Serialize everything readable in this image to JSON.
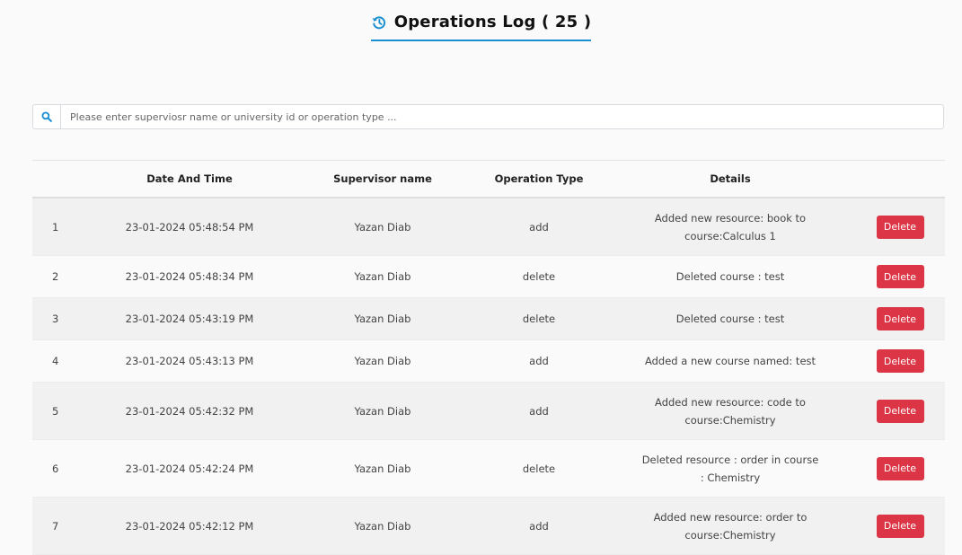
{
  "header": {
    "title": "Operations Log ( 25 )",
    "icon": "history-icon",
    "accent_color": "#1a8fd1"
  },
  "search": {
    "icon": "search-icon",
    "placeholder": "Please enter superviosr name or university id or operation type ..."
  },
  "table": {
    "columns": [
      "",
      "Date And Time",
      "Supervisor name",
      "Operation Type",
      "Details",
      ""
    ],
    "delete_label": "Delete",
    "delete_color": "#dc3545",
    "rows": [
      {
        "num": "1",
        "datetime": "23-01-2024 05:48:54 PM",
        "supervisor": "Yazan Diab",
        "operation": "add",
        "details": "Added new resource: book to course:Calculus 1"
      },
      {
        "num": "2",
        "datetime": "23-01-2024 05:48:34 PM",
        "supervisor": "Yazan Diab",
        "operation": "delete",
        "details": "Deleted course : test"
      },
      {
        "num": "3",
        "datetime": "23-01-2024 05:43:19 PM",
        "supervisor": "Yazan Diab",
        "operation": "delete",
        "details": "Deleted course : test"
      },
      {
        "num": "4",
        "datetime": "23-01-2024 05:43:13 PM",
        "supervisor": "Yazan Diab",
        "operation": "add",
        "details": "Added a new course named: test"
      },
      {
        "num": "5",
        "datetime": "23-01-2024 05:42:32 PM",
        "supervisor": "Yazan Diab",
        "operation": "add",
        "details": "Added new resource: code to course:Chemistry"
      },
      {
        "num": "6",
        "datetime": "23-01-2024 05:42:24 PM",
        "supervisor": "Yazan Diab",
        "operation": "delete",
        "details": "Deleted resource : order in course : Chemistry"
      },
      {
        "num": "7",
        "datetime": "23-01-2024 05:42:12 PM",
        "supervisor": "Yazan Diab",
        "operation": "add",
        "details": "Added new resource: order to course:Chemistry"
      }
    ]
  }
}
